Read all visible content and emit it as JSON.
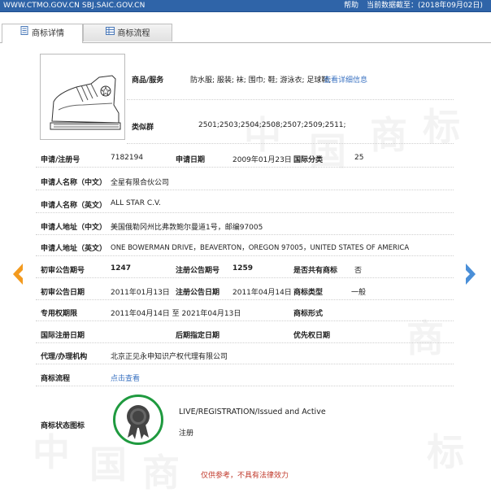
{
  "header": {
    "domains": "WWW.CTMO.GOV.CN SBJ.SAIC.GOV.CN",
    "help": "帮助",
    "update_date": "当前数据截至：(2018年09月02日)"
  },
  "tabs": [
    {
      "label": "商标详情",
      "active": true
    },
    {
      "label": "商标流程",
      "active": false
    }
  ],
  "details": {
    "goods_label": "商品/服务",
    "goods_value": "防水服; 服装; 袜; 围巾; 鞋; 游泳衣; 足球鞋;",
    "goods_link": "查看详细信息",
    "group_label": "类似群",
    "group_value": "2501;2503;2504;2508;2507;2509;2511;",
    "reg_no_label": "申请/注册号",
    "reg_no_value": "7182194",
    "app_date_label": "申请日期",
    "app_date_value": "2009年01月23日",
    "intl_class_label": "国际分类",
    "intl_class_value": "25",
    "applicant_cn_label": "申请人名称（中文）",
    "applicant_cn_value": "全星有限合伙公司",
    "applicant_en_label": "申请人名称（英文）",
    "applicant_en_value": "ALL STAR C.V.",
    "address_cn_label": "申请人地址（中文）",
    "address_cn_value": "美国俄勒冈州比弗敦鲍尔曼道1号，邮编97005",
    "address_en_label": "申请人地址（英文）",
    "address_en_value": "ONE BOWERMAN DRIVE，BEAVERTON，OREGON 97005，UNITED STATES OF AMERICA",
    "prelim_no_label": "初审公告期号",
    "prelim_no_value": "1247",
    "reg_pub_no_label": "注册公告期号",
    "reg_pub_no_value": "1259",
    "shared_label": "是否共有商标",
    "shared_value": "否",
    "prelim_date_label": "初审公告日期",
    "prelim_date_value": "2011年01月13日",
    "reg_pub_date_label": "注册公告日期",
    "reg_pub_date_value": "2011年04月14日",
    "type_label": "商标类型",
    "type_value": "一般",
    "exclusive_label": "专用权期限",
    "exclusive_value": "2011年04月14日 至 2021年04月13日",
    "form_label": "商标形式",
    "form_value": "",
    "intl_reg_date_label": "国际注册日期",
    "later_date_label": "后期指定日期",
    "priority_date_label": "优先权日期",
    "agent_label": "代理/办理机构",
    "agent_value": "北京正见永申知识产权代理有限公司",
    "process_label": "商标流程",
    "process_link": "点击查看",
    "status_label": "商标状态图标",
    "status_en": "LIVE/REGISTRATION/Issued and Active",
    "status_cn": "注册",
    "note": "仅供参考，不具有法律效力"
  },
  "colors": {
    "header_bg": "#2f64a8",
    "link": "#3b73c2",
    "seal_green": "#1f9a3f",
    "nav_left": "#f39a1e",
    "nav_right": "#4a8fd8",
    "note_red": "#c0392b"
  },
  "icons": {
    "tab1": "document-icon",
    "tab2": "grid-icon",
    "prev": "chevron-left-icon",
    "next": "chevron-right-icon",
    "status": "award-seal-icon"
  },
  "watermark": [
    "中",
    "国",
    "商",
    "标"
  ]
}
